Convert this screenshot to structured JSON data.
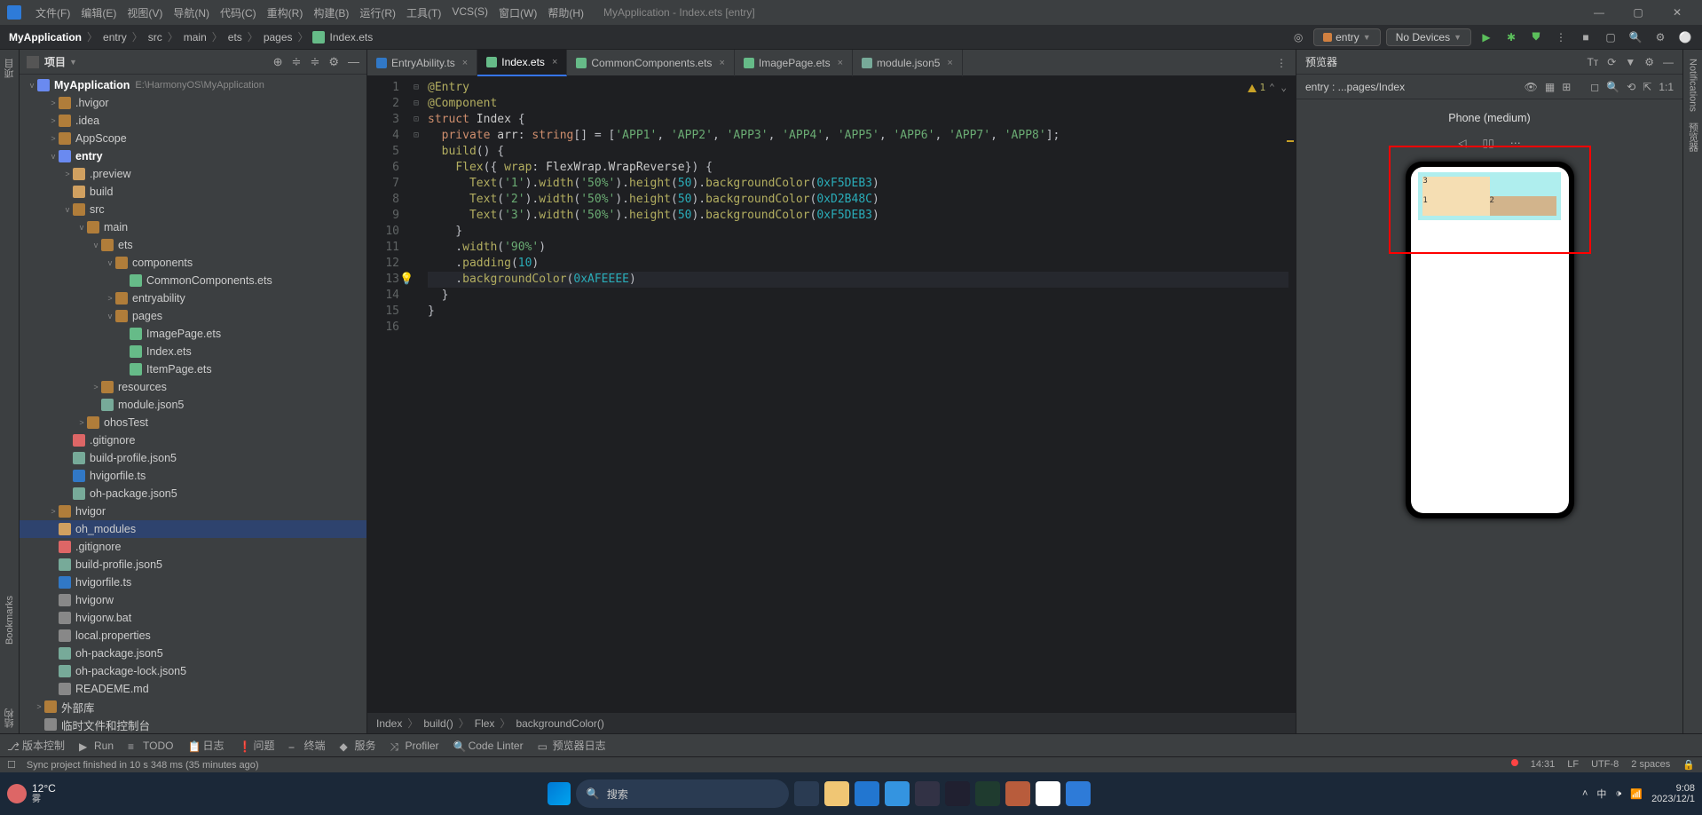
{
  "menubar": {
    "items": [
      "文件(F)",
      "编辑(E)",
      "视图(V)",
      "导航(N)",
      "代码(C)",
      "重构(R)",
      "构建(B)",
      "运行(R)",
      "工具(T)",
      "VCS(S)",
      "窗口(W)",
      "帮助(H)"
    ],
    "title": "MyApplication - Index.ets [entry]"
  },
  "navbar": {
    "crumbs": [
      "MyApplication",
      "entry",
      "src",
      "main",
      "ets",
      "pages",
      "Index.ets"
    ],
    "target_icon": "◎",
    "module_dropdown": "entry",
    "device_dropdown": "No Devices"
  },
  "project": {
    "header": "项目",
    "root": {
      "name": "MyApplication",
      "path": "E:\\HarmonyOS\\MyApplication"
    },
    "tree": [
      {
        "d": 1,
        "chev": ">",
        "icon": "fi-folder",
        "label": ".hvigor"
      },
      {
        "d": 1,
        "chev": ">",
        "icon": "fi-folder",
        "label": ".idea"
      },
      {
        "d": 1,
        "chev": ">",
        "icon": "fi-folder",
        "label": "AppScope"
      },
      {
        "d": 1,
        "chev": "v",
        "icon": "fi-module",
        "label": "entry",
        "bold": true
      },
      {
        "d": 2,
        "chev": ">",
        "icon": "fi-folder-light",
        "label": ".preview"
      },
      {
        "d": 2,
        "chev": "",
        "icon": "fi-folder-light",
        "label": "build"
      },
      {
        "d": 2,
        "chev": "v",
        "icon": "fi-folder",
        "label": "src"
      },
      {
        "d": 3,
        "chev": "v",
        "icon": "fi-folder",
        "label": "main"
      },
      {
        "d": 4,
        "chev": "v",
        "icon": "fi-folder",
        "label": "ets"
      },
      {
        "d": 5,
        "chev": "v",
        "icon": "fi-folder",
        "label": "components"
      },
      {
        "d": 6,
        "chev": "",
        "icon": "fi-ets",
        "label": "CommonComponents.ets"
      },
      {
        "d": 5,
        "chev": ">",
        "icon": "fi-folder",
        "label": "entryability"
      },
      {
        "d": 5,
        "chev": "v",
        "icon": "fi-folder",
        "label": "pages"
      },
      {
        "d": 6,
        "chev": "",
        "icon": "fi-ets",
        "label": "ImagePage.ets"
      },
      {
        "d": 6,
        "chev": "",
        "icon": "fi-ets",
        "label": "Index.ets"
      },
      {
        "d": 6,
        "chev": "",
        "icon": "fi-ets",
        "label": "ItemPage.ets"
      },
      {
        "d": 4,
        "chev": ">",
        "icon": "fi-folder",
        "label": "resources"
      },
      {
        "d": 4,
        "chev": "",
        "icon": "fi-json",
        "label": "module.json5"
      },
      {
        "d": 3,
        "chev": ">",
        "icon": "fi-folder",
        "label": "ohosTest"
      },
      {
        "d": 2,
        "chev": "",
        "icon": "fi-git",
        "label": ".gitignore"
      },
      {
        "d": 2,
        "chev": "",
        "icon": "fi-json",
        "label": "build-profile.json5"
      },
      {
        "d": 2,
        "chev": "",
        "icon": "fi-ts",
        "label": "hvigorfile.ts"
      },
      {
        "d": 2,
        "chev": "",
        "icon": "fi-json",
        "label": "oh-package.json5"
      },
      {
        "d": 1,
        "chev": ">",
        "icon": "fi-folder",
        "label": "hvigor"
      },
      {
        "d": 1,
        "chev": "",
        "icon": "fi-folder-light",
        "label": "oh_modules",
        "sel": true
      },
      {
        "d": 1,
        "chev": "",
        "icon": "fi-git",
        "label": ".gitignore"
      },
      {
        "d": 1,
        "chev": "",
        "icon": "fi-json",
        "label": "build-profile.json5"
      },
      {
        "d": 1,
        "chev": "",
        "icon": "fi-ts",
        "label": "hvigorfile.ts"
      },
      {
        "d": 1,
        "chev": "",
        "icon": "fi-txt",
        "label": "hvigorw"
      },
      {
        "d": 1,
        "chev": "",
        "icon": "fi-txt",
        "label": "hvigorw.bat"
      },
      {
        "d": 1,
        "chev": "",
        "icon": "fi-txt",
        "label": "local.properties"
      },
      {
        "d": 1,
        "chev": "",
        "icon": "fi-json",
        "label": "oh-package.json5"
      },
      {
        "d": 1,
        "chev": "",
        "icon": "fi-json",
        "label": "oh-package-lock.json5"
      },
      {
        "d": 1,
        "chev": "",
        "icon": "fi-txt",
        "label": "READEME.md"
      },
      {
        "d": 0,
        "chev": ">",
        "icon": "fi-folder",
        "label": "外部库"
      },
      {
        "d": 0,
        "chev": "",
        "icon": "fi-txt",
        "label": "临时文件和控制台"
      }
    ]
  },
  "tabs": [
    {
      "label": "EntryAbility.ts",
      "icon": "fi-ts"
    },
    {
      "label": "Index.ets",
      "icon": "fi-ets",
      "active": true
    },
    {
      "label": "CommonComponents.ets",
      "icon": "fi-ets"
    },
    {
      "label": "ImagePage.ets",
      "icon": "fi-ets"
    },
    {
      "label": "module.json5",
      "icon": "fi-json"
    }
  ],
  "code": {
    "warning_count": "1",
    "lines_numbers": [
      "1",
      "2",
      "3",
      "4",
      "5",
      "6",
      "7",
      "8",
      "9",
      "10",
      "11",
      "12",
      "13",
      "14",
      "15",
      "16"
    ],
    "fold": [
      "",
      "",
      "",
      "",
      "",
      "⊟",
      "⊟",
      "",
      "",
      "",
      "",
      "",
      "",
      "",
      "⊡",
      "⊡"
    ],
    "lines_html": [
      "<span class='anno'>@Entry</span>",
      "<span class='anno'>@Component</span>",
      "<span class='kw'>struct</span> <span class='cls'>Index</span> {",
      "  <span class='kw'>private</span> <span class='cls'>arr</span>: <span class='type'>string</span>[] = [<span class='str'>'APP1'</span>, <span class='str'>'APP2'</span>, <span class='str'>'APP3'</span>, <span class='str'>'APP4'</span>, <span class='str'>'APP5'</span>, <span class='str'>'APP6'</span>, <span class='str'>'APP7'</span>, <span class='str'>'APP8'</span>];",
      "",
      "  <span class='fn'>build</span>() {",
      "    <span class='fn'>Flex</span>({ <span class='prop'>wrap</span>: <span class='cls'>FlexWrap</span>.<span class='cls'>WrapReverse</span>}) {",
      "      <span class='fn'>Text</span>(<span class='str'>'1'</span>).<span class='fn'>width</span>(<span class='str'>'50%'</span>).<span class='fn'>height</span>(<span class='num'>50</span>).<span class='fn'>backgroundColor</span>(<span class='num'>0xF5DEB3</span>)",
      "      <span class='fn'>Text</span>(<span class='str'>'2'</span>).<span class='fn'>width</span>(<span class='str'>'50%'</span>).<span class='fn'>height</span>(<span class='num'>50</span>).<span class='fn'>backgroundColor</span>(<span class='num'>0xD2B48C</span>)",
      "      <span class='fn'>Text</span>(<span class='str'>'3'</span>).<span class='fn'>width</span>(<span class='str'>'50%'</span>).<span class='fn'>height</span>(<span class='num'>50</span>).<span class='fn'>backgroundColor</span>(<span class='num'>0xF5DEB3</span>)",
      "    }",
      "    .<span class='fn'>width</span>(<span class='str'>'90%'</span>)",
      "    .<span class='fn'>padding</span>(<span class='num'>10</span>)",
      "    .<span class='fn'>backgroundColor</span>(<span class='num'>0xAFEEEE</span>)",
      "  }",
      "}"
    ]
  },
  "editor_breadcrumb": [
    "Index",
    "build()",
    "Flex",
    "backgroundColor()"
  ],
  "preview": {
    "title": "预览器",
    "sub": "entry : ...pages/Index",
    "device_label": "Phone (medium)",
    "cells": {
      "c1": "1",
      "c2": "2",
      "c3": "3"
    }
  },
  "tool_windows": [
    {
      "icon": "⎇",
      "label": "版本控制"
    },
    {
      "icon": "▶",
      "label": "Run"
    },
    {
      "icon": "≡",
      "label": "TODO"
    },
    {
      "icon": "📋",
      "label": "日志"
    },
    {
      "icon": "❗",
      "label": "问题"
    },
    {
      "icon": "⎯",
      "label": "终端"
    },
    {
      "icon": "◆",
      "label": "服务"
    },
    {
      "icon": "⤨",
      "label": "Profiler"
    },
    {
      "icon": "🔍",
      "label": "Code Linter"
    },
    {
      "icon": "▭",
      "label": "预览器日志"
    }
  ],
  "statusbar": {
    "msg": "Sync project finished in 10 s 348 ms (35 minutes ago)",
    "time": "14:31",
    "eol": "LF",
    "enc": "UTF-8",
    "indent": "2 spaces"
  },
  "left_gutter": [
    "项目",
    "Bookmarks",
    "结构"
  ],
  "right_gutter": [
    "Notifications",
    "预览器"
  ],
  "taskbar": {
    "temp": "12°C",
    "weather": "雾",
    "search_placeholder": "搜索",
    "clock_time": "9:08",
    "clock_date": "2023/12/1"
  }
}
